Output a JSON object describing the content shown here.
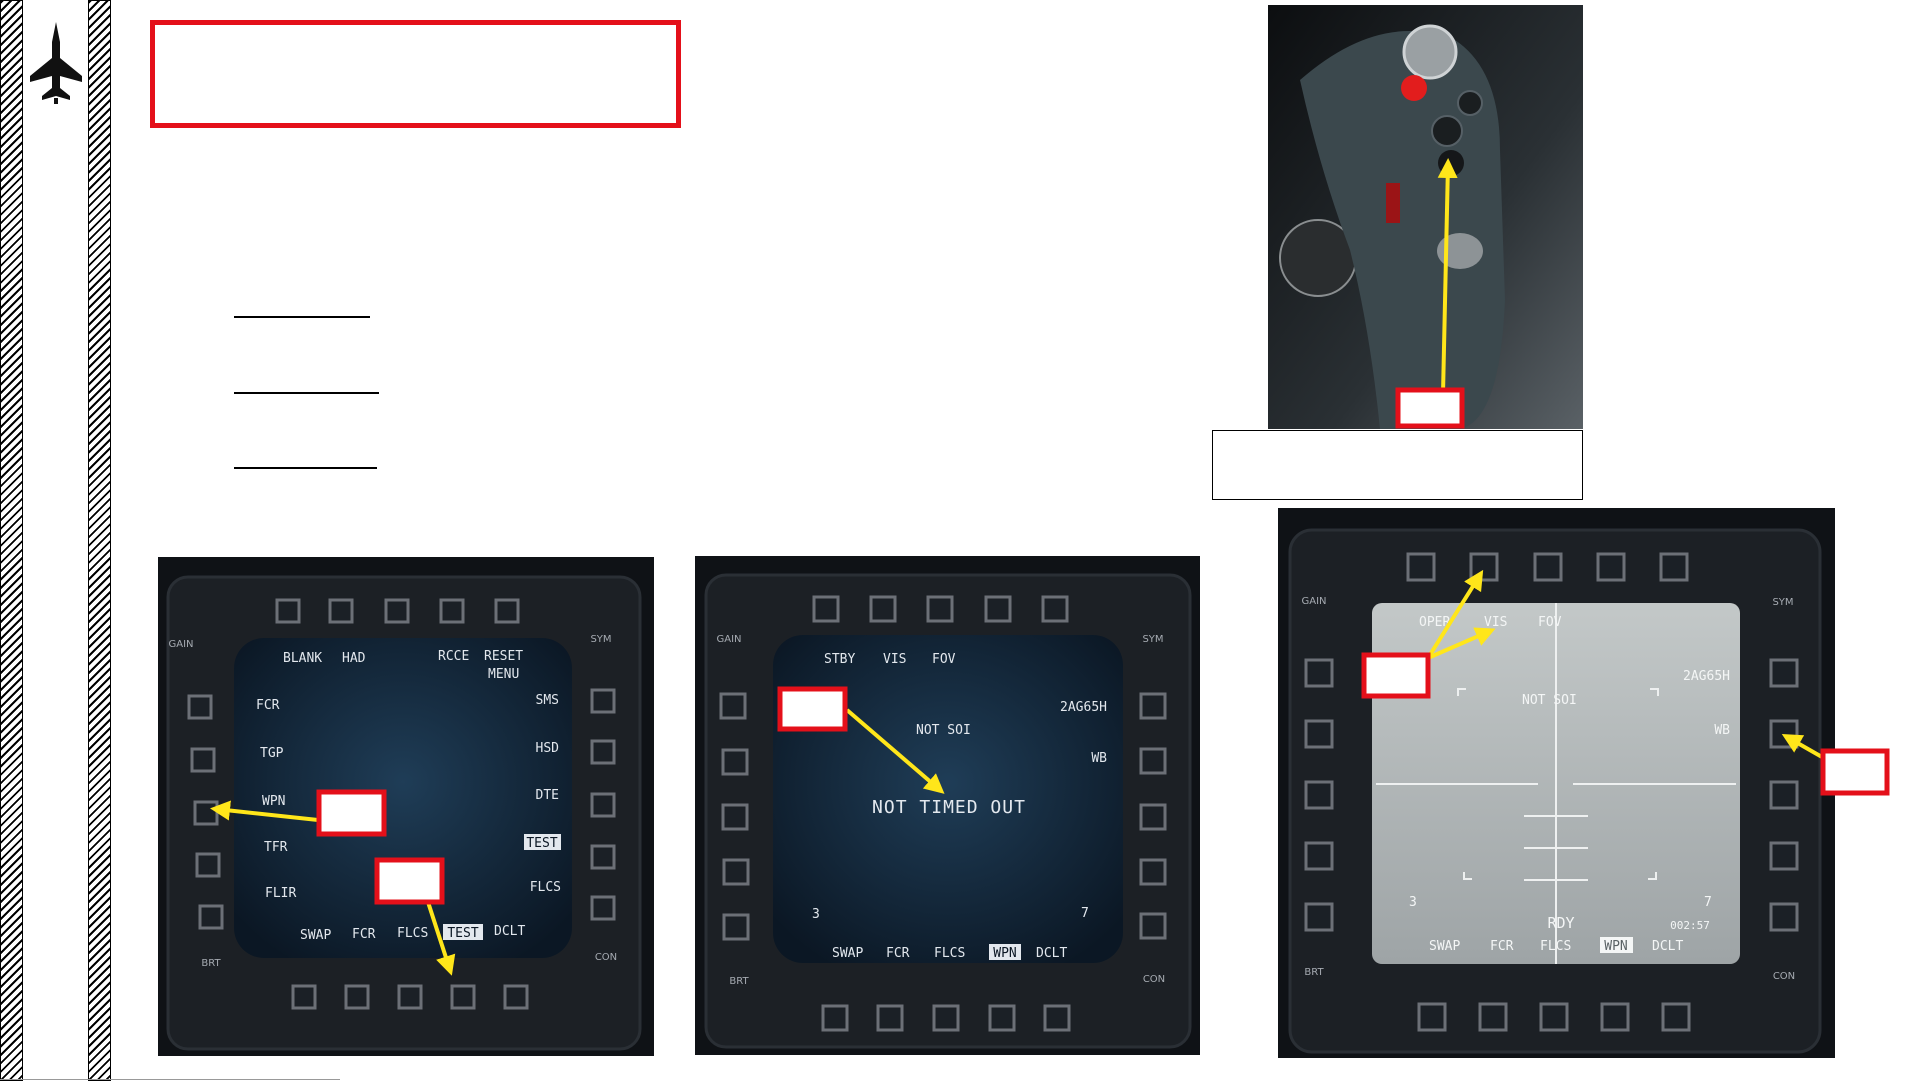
{
  "colors": {
    "callout_red": "#e4101a",
    "arrow_yellow": "#ffe61a",
    "mfd_bezel": "#1b1f24",
    "mfd_screen_dark": "#0f2131",
    "mfd_screen_tv": "#adb3b4",
    "stick_grip": "#3b484d"
  },
  "icons": {
    "logo": "fighter-jet-icon",
    "stick": "control-stick-photo-icon"
  },
  "mfd_left": {
    "rocker_gain": "GAIN",
    "rocker_sym": "SYM",
    "rocker_brt": "BRT",
    "rocker_con": "CON",
    "top": [
      "BLANK",
      "HAD",
      "RCCE",
      "RESET"
    ],
    "top_sub": "MENU",
    "left": [
      "FCR",
      "TGP",
      "WPN",
      "TFR",
      "FLIR"
    ],
    "right": [
      "SMS",
      "HSD",
      "DTE",
      "TEST",
      "FLCS"
    ],
    "bottom": [
      "SWAP",
      "FCR",
      "FLCS",
      "TEST",
      "DCLT"
    ]
  },
  "mfd_middle": {
    "rocker_gain": "GAIN",
    "rocker_sym": "SYM",
    "rocker_brt": "BRT",
    "rocker_con": "CON",
    "top": [
      "STBY",
      "VIS",
      "FOV"
    ],
    "status": "NOT SOI",
    "message": "NOT TIMED OUT",
    "weapon": "2AG65H",
    "wb": "WB",
    "left_num": "3",
    "right_num": "7",
    "bottom": [
      "SWAP",
      "FCR",
      "FLCS",
      "WPN",
      "DCLT"
    ]
  },
  "mfd_right": {
    "rocker_gain": "GAIN",
    "rocker_sym": "SYM",
    "rocker_brt": "BRT",
    "rocker_con": "CON",
    "top": [
      "OPER",
      "VIS",
      "FOV"
    ],
    "status": "NOT SOI",
    "weapon": "2AG65H",
    "wb": "WB",
    "left_num": "3",
    "right_num": "7",
    "rdy": "RDY",
    "time": "002:57",
    "bottom": [
      "SWAP",
      "FCR",
      "FLCS",
      "WPN",
      "DCLT"
    ]
  }
}
